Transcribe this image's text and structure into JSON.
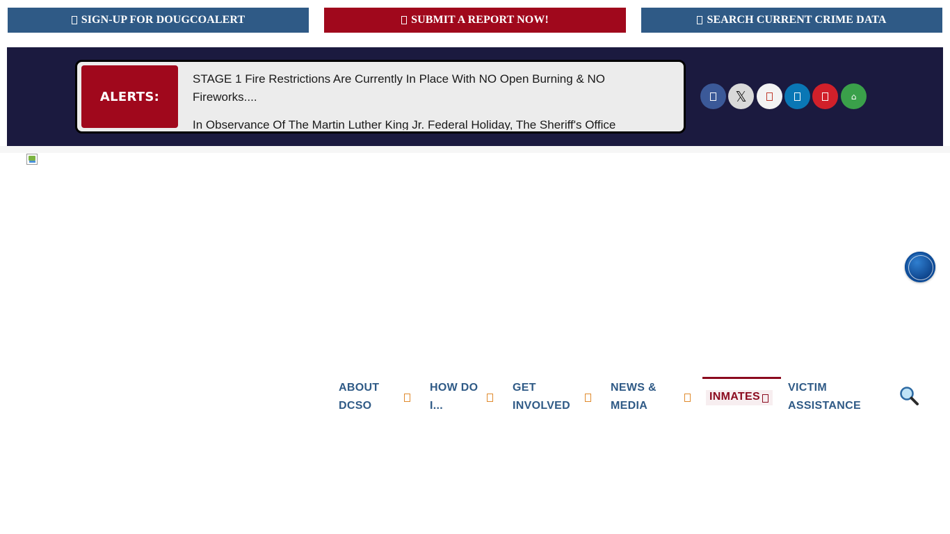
{
  "top_buttons": {
    "signup": "SIGN-UP FOR DOUGCOALERT",
    "report": "SUBMIT A REPORT NOW!",
    "crime": "SEARCH CURRENT CRIME DATA"
  },
  "alerts": {
    "label": "ALERTS:",
    "items": [
      "STAGE 1 Fire Restrictions Are Currently In Place With NO Open Burning & NO Fireworks....",
      "In Observance Of The Martin Luther King Jr. Federal Holiday, The Sheriff's Office"
    ]
  },
  "social": {
    "x_glyph": "𝕏",
    "nextdoor_glyph": "⌂"
  },
  "nav": {
    "items": [
      {
        "label": "ABOUT DCSO"
      },
      {
        "label": "HOW DO I..."
      },
      {
        "label": "GET INVOLVED"
      },
      {
        "label": "NEWS & MEDIA"
      },
      {
        "label": "INMATES"
      },
      {
        "label": "VICTIM ASSISTANCE"
      }
    ],
    "active": "INMATES"
  },
  "colors": {
    "primary_blue": "#2f5a86",
    "brand_red": "#a0081c",
    "band_navy": "#1b1a3f",
    "caret_orange": "#e08a2c"
  }
}
